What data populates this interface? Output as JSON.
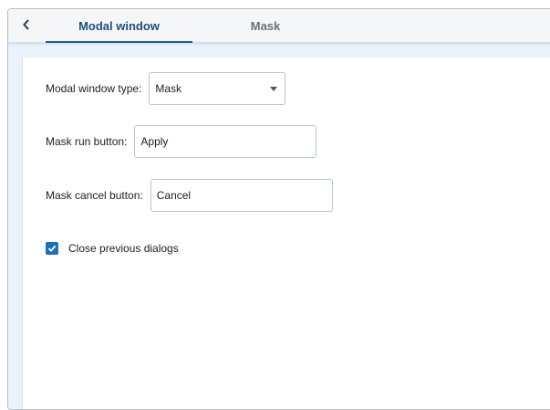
{
  "tabs": [
    {
      "label": "Modal window",
      "active": true
    },
    {
      "label": "Mask",
      "active": false
    }
  ],
  "form": {
    "modal_type": {
      "label": "Modal window type:",
      "value": "Mask"
    },
    "run_button": {
      "label": "Mask run button:",
      "value": "Apply"
    },
    "cancel_button": {
      "label": "Mask cancel button:",
      "value": "Cancel"
    },
    "close_previous": {
      "label": "Close previous dialogs",
      "checked": true
    }
  },
  "colors": {
    "accent": "#1f5a96",
    "checkbox": "#1f6fbf",
    "background": "#eaf3fc"
  },
  "icons": {
    "back": "chevron-left-icon",
    "dropdown": "caret-down-icon",
    "check": "checkmark-icon"
  }
}
